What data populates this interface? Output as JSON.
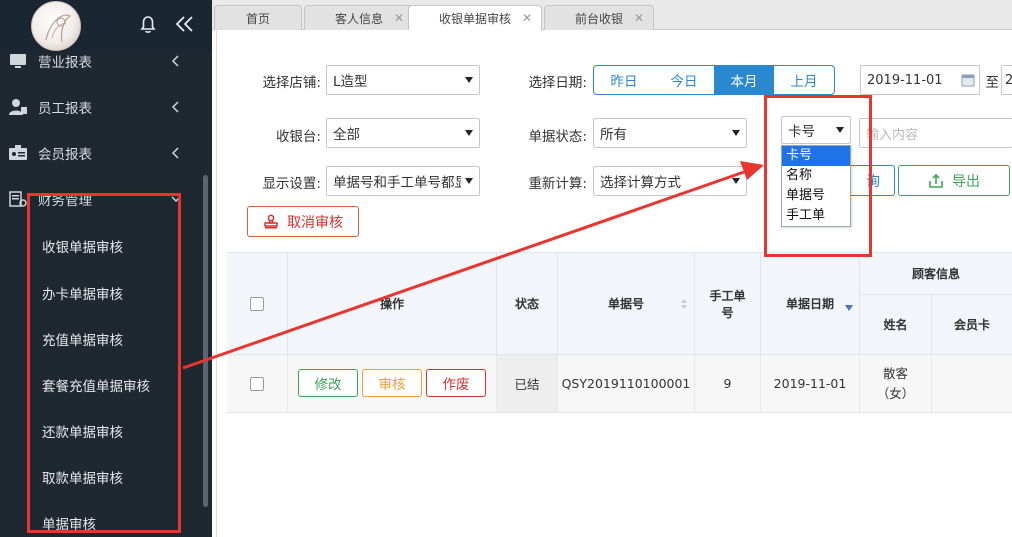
{
  "sidebar": {
    "items": [
      {
        "label": "营业报表"
      },
      {
        "label": "员工报表"
      },
      {
        "label": "会员报表"
      },
      {
        "label": "财务管理"
      }
    ],
    "subitems": [
      {
        "label": "收银单据审核"
      },
      {
        "label": "办卡单据审核"
      },
      {
        "label": "充值单据审核"
      },
      {
        "label": "套餐充值单据审核"
      },
      {
        "label": "还款单据审核"
      },
      {
        "label": "取款单据审核"
      },
      {
        "label": "单据审核"
      }
    ]
  },
  "tabs": [
    {
      "label": "首页"
    },
    {
      "label": "客人信息"
    },
    {
      "label": "收银单据审核"
    },
    {
      "label": "前台收银"
    }
  ],
  "filters": {
    "store_label": "选择店铺:",
    "store_value": "L造型",
    "date_label": "选择日期:",
    "date_buttons": [
      "昨日",
      "今日",
      "本月",
      "上月"
    ],
    "date_from": "2019-11-01",
    "date_to_label": "至",
    "date_to_partial": "2",
    "cashier_label": "收银台:",
    "cashier_value": "全部",
    "status_label": "单据状态:",
    "status_value": "所有",
    "search_field_value": "卡号",
    "search_placeholder": "输入内容",
    "display_label": "显示设置:",
    "display_value": "单据号和手工单号都显示",
    "recalc_label": "重新计算:",
    "recalc_value": "选择计算方式",
    "query_label_partial": "询",
    "export_label": "导出",
    "cancel_audit_label": "取消审核"
  },
  "dropdown_options": [
    "卡号",
    "名称",
    "单据号",
    "手工单"
  ],
  "table": {
    "headers": {
      "op": "操作",
      "status": "状态",
      "bill_no": "单据号",
      "manual_no": "手工单号",
      "bill_date": "单据日期",
      "customer_group": "顾客信息",
      "name": "姓名",
      "member_card": "会员卡"
    },
    "rows": [
      {
        "edit": "修改",
        "audit": "审核",
        "void": "作废",
        "status": "已结",
        "bill_no": "QSY2019110100001",
        "manual_no": "9",
        "bill_date": "2019-11-01",
        "name": "散客（女）"
      }
    ]
  },
  "colors": {
    "sidebar_bg": "#1f2730",
    "accent_blue": "#2a88d0",
    "highlight_red": "#e8352f",
    "edit_green": "#3aa655",
    "audit_orange": "#f0a030",
    "void_red": "#d9302c"
  }
}
